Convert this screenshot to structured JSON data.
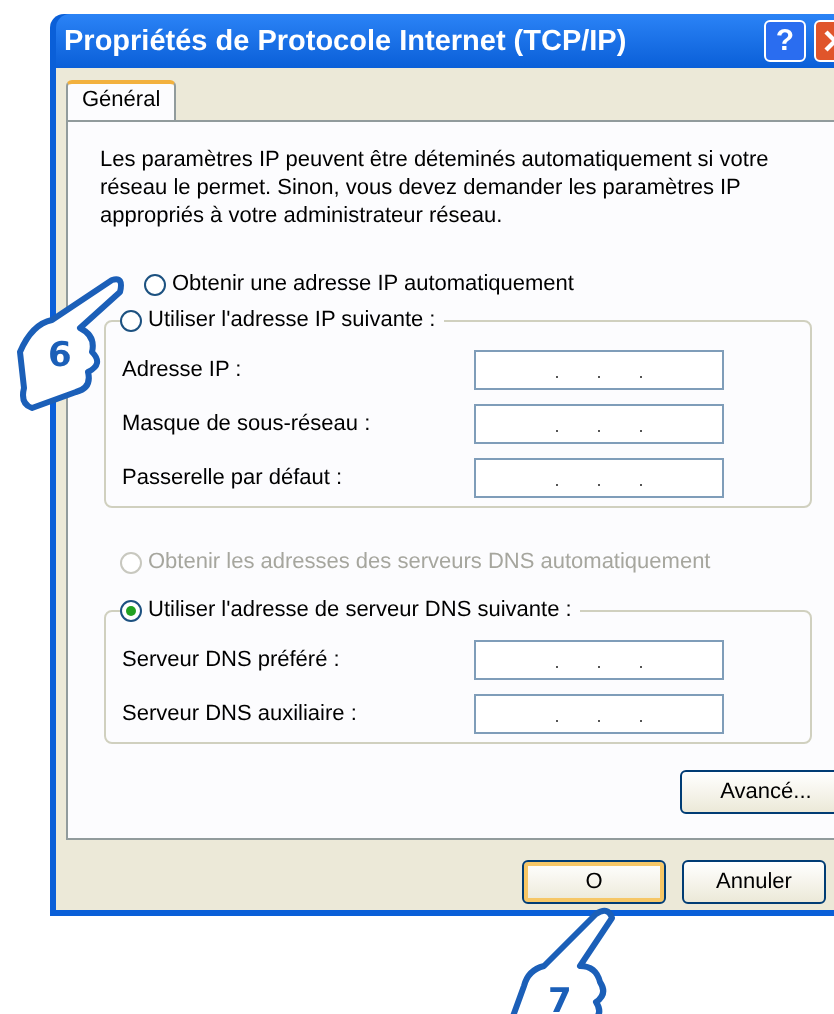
{
  "window": {
    "title": "Propriétés de Protocole Internet (TCP/IP)",
    "help": "?"
  },
  "tabs": [
    {
      "label": "Général",
      "selected": true
    }
  ],
  "intro": "Les paramètres IP peuvent être déteminés automatiquement si votre réseau le permet. Sinon, vous devez demander les paramètres IP appropriés à votre administrateur réseau.",
  "ip_options": [
    {
      "label": "Obtenir une adresse IP automatiquement",
      "selected": false,
      "disabled": false
    },
    {
      "label": "Utiliser l'adresse IP suivante :",
      "selected": false,
      "disabled": false
    }
  ],
  "ip_fields": [
    {
      "label": "Adresse IP :"
    },
    {
      "label": "Masque de sous-réseau :"
    },
    {
      "label": "Passerelle par défaut :"
    }
  ],
  "dns_options": [
    {
      "label": "Obtenir les adresses des serveurs DNS automatiquement",
      "selected": false,
      "disabled": true
    },
    {
      "label": "Utiliser l'adresse de serveur DNS suivante :",
      "selected": true,
      "disabled": false
    }
  ],
  "dns_fields": [
    {
      "label": "Serveur DNS préféré :"
    },
    {
      "label": "Serveur DNS auxiliaire :"
    }
  ],
  "advanced_button": "Avancé...",
  "buttons": [
    {
      "label": "O",
      "default": true
    },
    {
      "label": "Annuler",
      "default": false
    }
  ],
  "callouts": [
    {
      "number": "6"
    },
    {
      "number": "7"
    }
  ]
}
